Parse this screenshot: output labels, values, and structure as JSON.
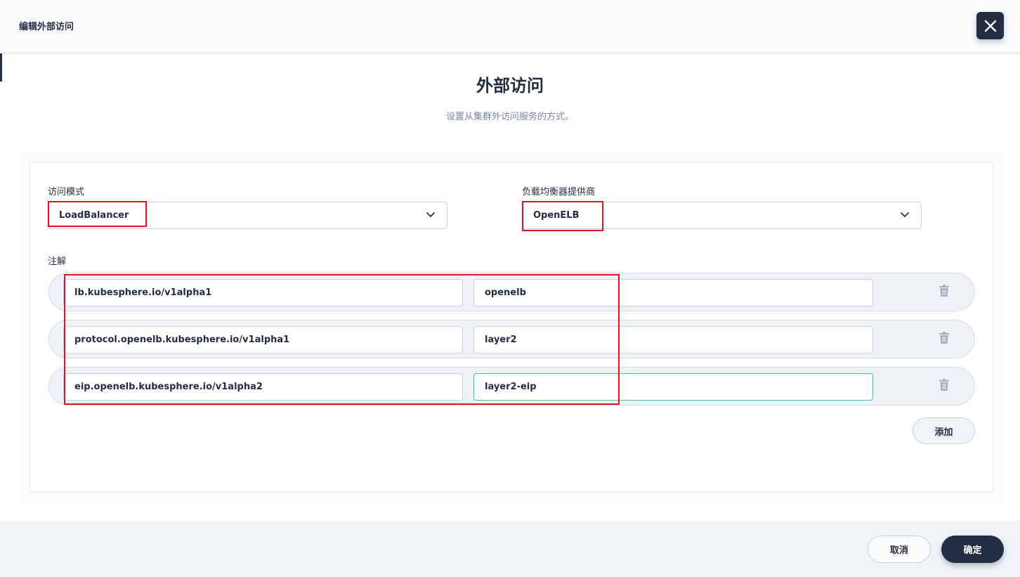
{
  "dialog": {
    "title": "编辑外部访问",
    "close_icon": "close-icon"
  },
  "section": {
    "title": "外部访问",
    "description": "设置从集群外访问服务的方式。"
  },
  "access_mode": {
    "label": "访问模式",
    "value": "LoadBalancer"
  },
  "lb_provider": {
    "label": "负载均衡器提供商",
    "value": "OpenELB"
  },
  "annotations": {
    "label": "注解",
    "rows": [
      {
        "key": "lb.kubesphere.io/v1alpha1",
        "value": "openelb"
      },
      {
        "key": "protocol.openelb.kubesphere.io/v1alpha1",
        "value": "layer2"
      },
      {
        "key": "eip.openelb.kubesphere.io/v1alpha2",
        "value": "layer2-eip"
      }
    ],
    "add_label": "添加"
  },
  "footer": {
    "cancel_label": "取消",
    "ok_label": "确定"
  },
  "colors": {
    "primary": "#242e42",
    "highlight": "#e0141f",
    "focus_border": "#55bc8a"
  }
}
